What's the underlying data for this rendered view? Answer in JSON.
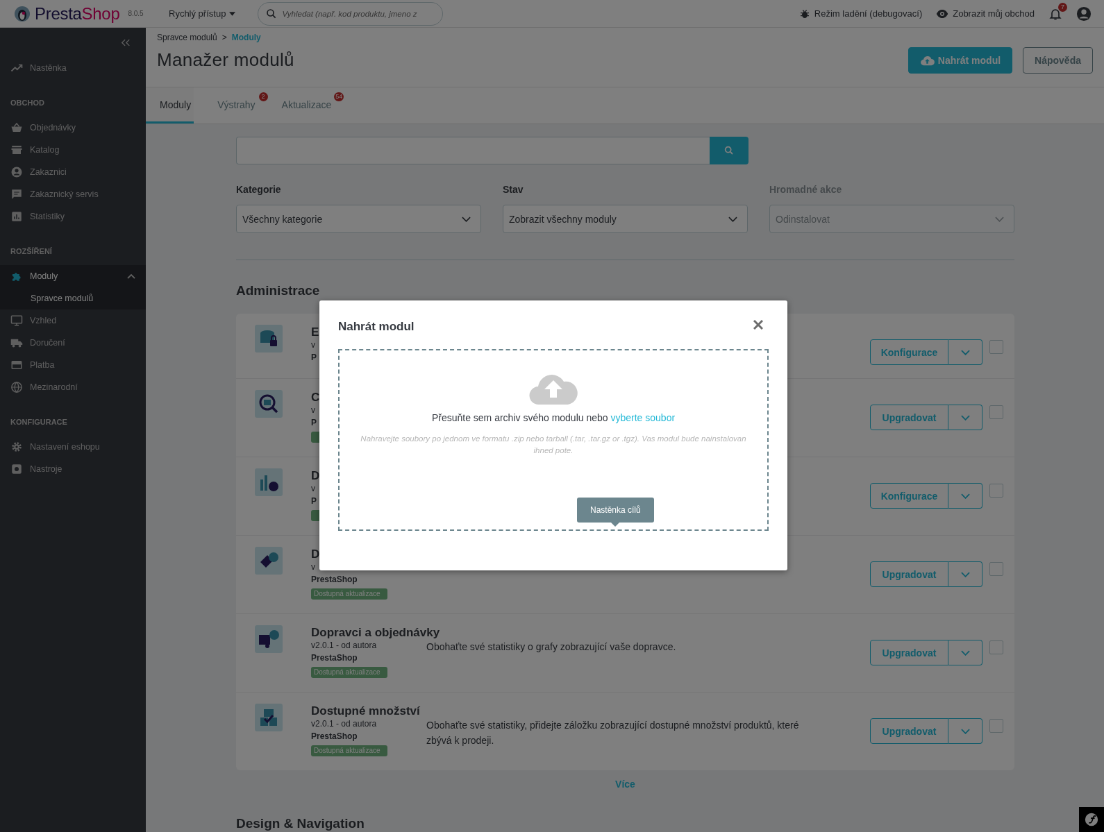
{
  "topbar": {
    "brand": {
      "name_dark": "Presta",
      "name_accent": "Shop",
      "version": "8.0.5"
    },
    "quick_access": "Rychlý přístup",
    "search": {
      "placeholder": "Vyhledat (např. kod produktu, jmeno z"
    },
    "debug_mode": "Režim ladění (debugovací)",
    "view_shop": "Zobrazit můj obchod",
    "notifications": "7"
  },
  "sidebar": {
    "items": [
      {
        "kind": "link",
        "label": "Nastěnka",
        "selected": false
      },
      {
        "kind": "heading",
        "label": "OBCHOD"
      },
      {
        "kind": "link",
        "label": "Objednávky",
        "selected": false
      },
      {
        "kind": "link",
        "label": "Katalog",
        "selected": false
      },
      {
        "kind": "link",
        "label": "Zakaznici",
        "selected": false
      },
      {
        "kind": "link",
        "label": "Zakaznický servis",
        "selected": false
      },
      {
        "kind": "link",
        "label": "Statistiky",
        "selected": false
      },
      {
        "kind": "heading",
        "label": "ROZŠÍŘENÍ"
      },
      {
        "kind": "link",
        "label": "Moduly",
        "selected": true,
        "expanded": true,
        "children": [
          {
            "label": "Spravce modulů",
            "selected": false
          }
        ]
      },
      {
        "kind": "link",
        "label": "Vzhled",
        "selected": false
      },
      {
        "kind": "link",
        "label": "Doručení",
        "selected": false
      },
      {
        "kind": "link",
        "label": "Platba",
        "selected": false
      },
      {
        "kind": "link",
        "label": "Mezinarodní",
        "selected": false
      },
      {
        "kind": "heading",
        "label": "KONFIGURACE"
      },
      {
        "kind": "link",
        "label": "Nastavení eshopu",
        "selected": false
      },
      {
        "kind": "link",
        "label": "Nastroje",
        "selected": false
      }
    ]
  },
  "header": {
    "breadcrumb": {
      "items": [
        "Spravce modulů",
        "Moduly"
      ],
      "separator": ">"
    },
    "title": "Manažer modulů",
    "buttons": [
      {
        "label": "Nahrát modul",
        "kind": "primary"
      },
      {
        "label": "Nápověda",
        "kind": "secondary"
      }
    ]
  },
  "tabs": [
    {
      "label": "Moduly",
      "selected": true
    },
    {
      "label": "Výstrahy",
      "selected": false,
      "badge": "2"
    },
    {
      "label": "Aktualizace",
      "selected": false,
      "badge": "54"
    }
  ],
  "filters": [
    {
      "label": "Kategorie",
      "value": "Všechny kategorie",
      "disabled": false
    },
    {
      "label": "Stav",
      "value": "Zobrazit všechny moduly",
      "disabled": false
    },
    {
      "label": "Hromadné akce",
      "value": "Odinstalovat",
      "disabled": true
    }
  ],
  "sections": [
    {
      "title": "Administrace",
      "modules": [
        {
          "name": "E",
          "version": "v",
          "author": "P",
          "update_available": false,
          "action": "Konfigurace",
          "checked": false
        },
        {
          "name": "C",
          "version": "v",
          "author": "P",
          "update_available": true,
          "action": "Upgradovat",
          "checked": false
        },
        {
          "name": "D",
          "version": "v",
          "author": "P",
          "update_available": true,
          "action": "Konfigurace",
          "checked": false
        },
        {
          "name": "D",
          "version": "v",
          "author": "PrestaShop",
          "update_available": true,
          "badge": "Dostupná aktualizace",
          "action": "Upgradovat",
          "checked": false
        },
        {
          "name": "Dopravci a objednávky",
          "version": "v2.0.1 - od autora",
          "author": "PrestaShop",
          "update_available": true,
          "badge": "Dostupná aktualizace",
          "description": "Obohaťte své statistiky o grafy zobrazující vaše dopravce.",
          "action": "Upgradovat",
          "checked": false
        },
        {
          "name": "Dostupné množství",
          "version": "v2.0.1 - od autora",
          "author": "PrestaShop",
          "update_available": true,
          "badge": "Dostupná aktualizace",
          "description": "Obohaťte své statistiky, přidejte záložku zobrazující dostupné množství produktů, které zbývá k prodeji.",
          "action": "Upgradovat",
          "checked": false
        }
      ],
      "more": "Více"
    },
    {
      "title": "Design & Navigation"
    }
  ],
  "modal": {
    "title": "Nahrát modul",
    "prompt": "Přesuňte sem archiv svého modulu nebo",
    "link": "vyberte soubor",
    "hint": "Nahravejte soubory po jednom ve formatu .zip nebo tarball (.tar, .tar.gz or .tgz). Vas modul bude nainstalovan ihned pote.",
    "tooltip": "Nastěnka cílů"
  }
}
